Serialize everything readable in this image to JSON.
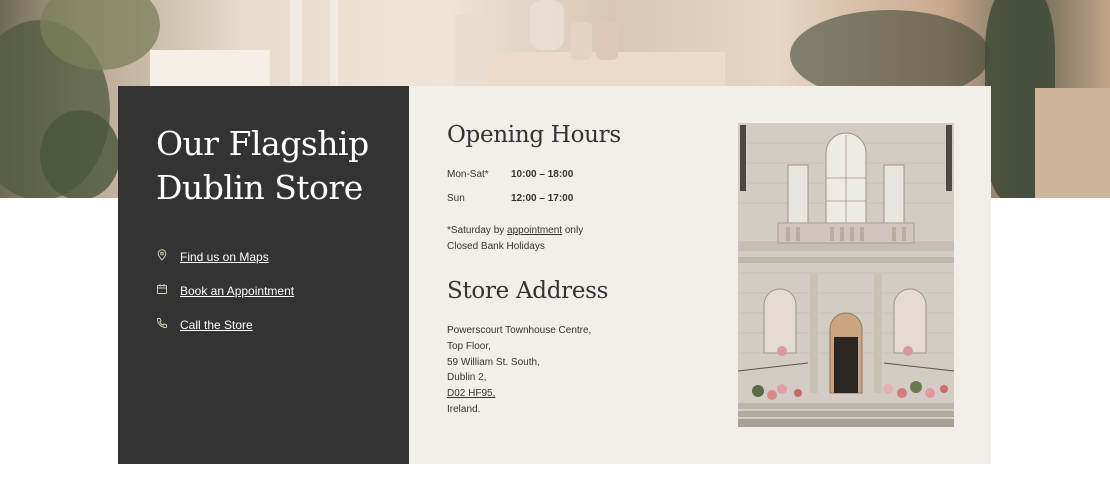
{
  "store_title": "Our Flagship Dublin Store",
  "links": {
    "maps": "Find us on Maps",
    "appointment": "Book an Appointment",
    "call": "Call the Store"
  },
  "icons": {
    "maps": "map-pin-icon",
    "appointment": "calendar-icon",
    "call": "phone-icon"
  },
  "opening_hours": {
    "title": "Opening Hours",
    "rows": [
      {
        "day": "Mon-Sat*",
        "time": "10:00 – 18:00"
      },
      {
        "day": "Sun",
        "time": "12:00 – 17:00"
      }
    ],
    "note_prefix": "*Saturday by ",
    "note_link": "appointment",
    "note_suffix": " only",
    "closed_note": "Closed Bank Holidays"
  },
  "address": {
    "title": "Store Address",
    "lines": [
      "Powerscourt Townhouse Centre,",
      "Top Floor,",
      "59 William St. South,",
      "Dublin 2,"
    ],
    "eircode": "D02 HF95,",
    "country": "Ireland."
  },
  "colors": {
    "dark_panel": "#333333",
    "light_panel": "#f2efeb",
    "text": "#333333"
  }
}
